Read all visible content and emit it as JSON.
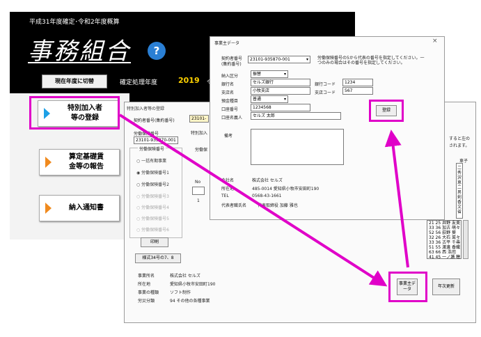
{
  "main": {
    "title": "平成31年度確定･令和2年度概算",
    "app_name": "事務組合",
    "help_label": "?",
    "switch_button": "現在年度に切替",
    "year_label": "確定処理年度",
    "year_value": "2019",
    "year_extra": "令",
    "buttons": [
      {
        "label1": "特別加入者",
        "label2": "等の登録",
        "color": "#1ea0e6"
      },
      {
        "label1": "算定基礎賃",
        "label2": "金等の報告",
        "color": "#f08a1e"
      },
      {
        "label1": "納入通知書",
        "label2": "",
        "color": "#f08a1e"
      }
    ]
  },
  "registration": {
    "title": "特別加入者等の登録",
    "contract_label": "契約者番号(集約番号)",
    "contract_value": "23101-",
    "ins_number_label": "労働保険番号",
    "ins_number_value": "23101-935870-001",
    "ins_group_label": "労働保険番号",
    "radios": [
      "一括有期事業",
      "労働保険番号1",
      "労働保険番号2",
      "労働保険番号3",
      "労働保険番号4",
      "労働保険番号5",
      "労働保険番号6"
    ],
    "print_button": "印刷",
    "form_button": "様式34号の7、8",
    "special_label": "特別加入",
    "labor_label": "労働保",
    "no_label": "No",
    "row_one": "1",
    "right_text1": "すると左の",
    "right_text2": "されます。",
    "right_name": "車子",
    "list_rows": [
      "21 25 井野 友美",
      "33 36 加古 萌々",
      "52 56 荻野 葵",
      "32 26 大石 菜々",
      "33 36 古平 千尋",
      "51 55 渡邊 香織",
      "63 66 西 浩司",
      "41 45 一ノ瀬 穂",
      "63 66 小柳 翔也"
    ],
    "list_side": [
      "二",
      "秀",
      "沢",
      "恵",
      "二",
      "男",
      "剣",
      "香",
      "文",
      "省",
      "乃"
    ],
    "info": [
      {
        "label": "事業所名",
        "value": "株式会社 セルズ"
      },
      {
        "label": "所在地",
        "value": "愛知県小牧市安田町190"
      },
      {
        "label": "事業の種類",
        "value": "ソフト制作"
      },
      {
        "label": "労災分類",
        "value": "94 その他の各種事業"
      }
    ],
    "owner_data_button": "事業主データ",
    "year_update_button": "年次更新"
  },
  "owner": {
    "title": "事業主データ",
    "close": "×",
    "contract_label": "契約者番号(集約番号)",
    "contract_value": "23101-935870-001",
    "note": "労働保険番号の5から代表の番号を指定してください。一つのみの場合はその番号を指定してください。",
    "payment_label": "納入区分",
    "payment_value": "振替",
    "bank_label": "銀行名",
    "bank_value": "セルズ銀行",
    "bank_code_label": "銀行コード",
    "bank_code_value": "1234",
    "branch_label": "支店名",
    "branch_value": "小牧支店",
    "branch_code_label": "支店コード",
    "branch_code_value": "567",
    "deposit_label": "預金種目",
    "deposit_value": "普通",
    "account_label": "口座番号",
    "account_value": "1234568",
    "holder_label": "口座名義人",
    "holder_value": "セルズ 太郎",
    "remarks_label": "備考",
    "register_button": "登録",
    "company": [
      {
        "label": "会社名",
        "value": "株式会社 セルズ"
      },
      {
        "label": "所在地",
        "value": "485-0014 愛知県小牧市安田町190"
      },
      {
        "label": "TEL",
        "value": "0568-43-1661"
      },
      {
        "label": "代表者職氏名",
        "value": "代表取締役 加藤 雅也"
      }
    ]
  },
  "colors": {
    "highlight": "#e000c8",
    "main_bg": "#000000",
    "year": "#ffd200"
  }
}
